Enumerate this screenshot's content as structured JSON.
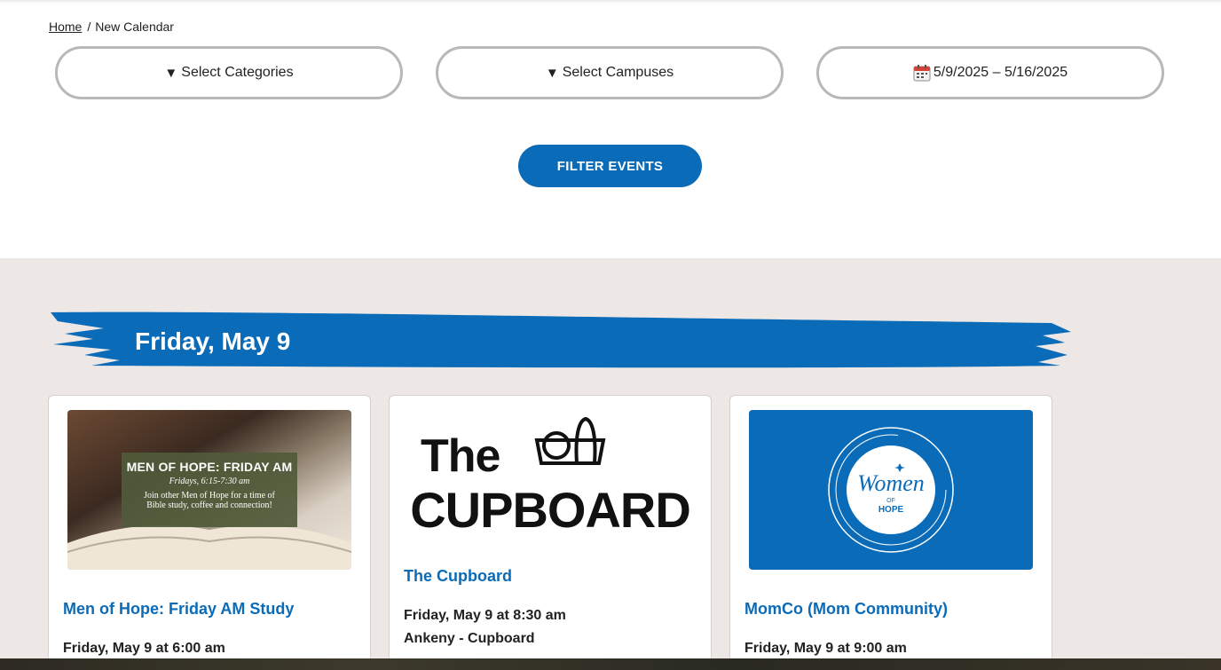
{
  "breadcrumb": {
    "home": "Home",
    "separator": "/",
    "current": "New Calendar"
  },
  "filters": {
    "categories": {
      "icon": "triangle-down-icon",
      "label": "Select Categories"
    },
    "campuses": {
      "icon": "triangle-down-icon",
      "label": "Select Campuses"
    },
    "dates": {
      "icon": "calendar-icon",
      "label": "5/9/2025 – 5/16/2025"
    },
    "button_label": "FILTER EVENTS"
  },
  "colors": {
    "accent": "#0a6bb8",
    "section_bg": "#ede7e5",
    "pill_border": "#b8b8b8"
  },
  "day": {
    "title": "Friday, May 9"
  },
  "events": [
    {
      "title": "Men of Hope: Friday AM Study",
      "when": "Friday, May 9 at 6:00 am",
      "image": {
        "heading": "MEN OF HOPE: FRIDAY AM",
        "subheading": "Fridays, 6:15-7:30 am",
        "line1": "Join other Men of Hope for a time of",
        "line2": "Bible study, coffee and connection!"
      }
    },
    {
      "title": "The Cupboard",
      "when": "Friday, May 9 at 8:30 am",
      "where": "Ankeny - Cupboard",
      "image": {
        "word1": "The",
        "word2": "CUPBOARD"
      }
    },
    {
      "title": "MomCo (Mom Community)",
      "when": "Friday, May 9 at 9:00 am",
      "image": {
        "script": "Women",
        "of": "OF",
        "hope": "HOPE"
      }
    }
  ]
}
